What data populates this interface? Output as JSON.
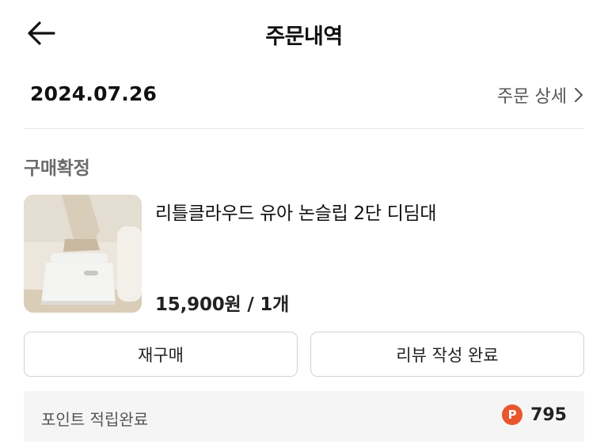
{
  "header": {
    "title": "주문내역",
    "back_icon": "arrow-left-icon"
  },
  "order": {
    "date": "2024.07.26",
    "detail_link": "주문 상세",
    "detail_icon": "chevron-right-icon",
    "status": "구매확정"
  },
  "product": {
    "name": "리틀클라우드 유아 논슬립 2단 디딤대",
    "price_qty": "15,900원 / 1개",
    "image_desc_icon": "product-thumbnail"
  },
  "actions": {
    "rebuy_label": "재구매",
    "review_label": "리뷰 작성 완료"
  },
  "points": {
    "label": "포인트 적립완료",
    "icon_letter": "P",
    "value": "795",
    "icon_color": "#e9552c"
  }
}
